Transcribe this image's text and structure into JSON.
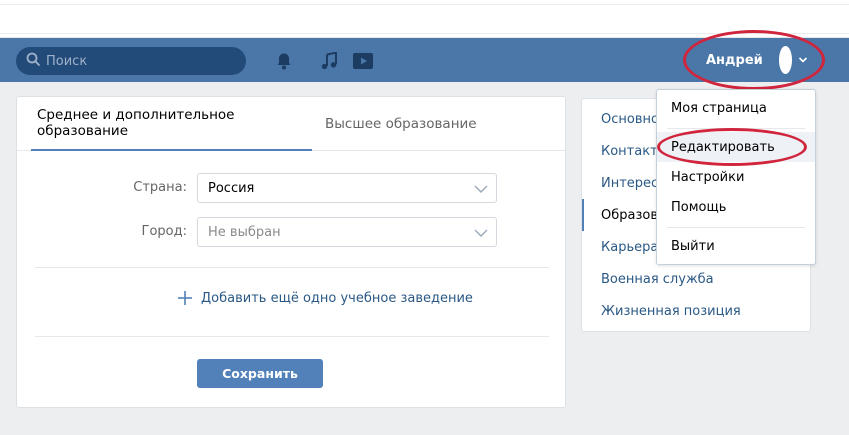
{
  "header": {
    "search_placeholder": "Поиск",
    "user_name": "Андрей",
    "icons": [
      "search-icon",
      "bell-icon",
      "music-icon",
      "video-icon",
      "chevron-down-icon"
    ]
  },
  "education": {
    "tabs": [
      "Среднее и дополнительное образование",
      "Высшее образование"
    ],
    "country_label": "Страна:",
    "country_value": "Россия",
    "city_label": "Город:",
    "city_value": "Не выбран",
    "add_label": "Добавить ещё одно учебное заведение",
    "save_label": "Сохранить"
  },
  "side_menu": {
    "items": [
      "Основное",
      "Контакты",
      "Интересы",
      "Образование",
      "Карьера",
      "Военная служба",
      "Жизненная позиция"
    ],
    "active_index": 3
  },
  "dropdown": {
    "items": [
      "Моя страница",
      "Редактировать",
      "Настройки",
      "Помощь",
      "Выйти"
    ],
    "hover_index": 1
  },
  "colors": {
    "header_bg": "#4a76a8",
    "link": "#2a5885",
    "button": "#5181b8",
    "annotation": "#d0253c"
  }
}
